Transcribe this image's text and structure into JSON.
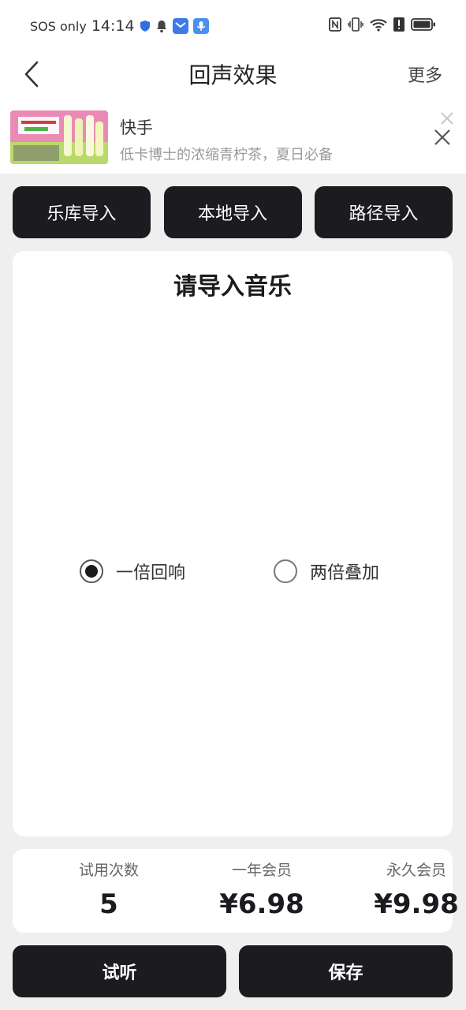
{
  "status_bar": {
    "carrier": "SOS only",
    "time": "14:14"
  },
  "header": {
    "title": "回声效果",
    "more_label": "更多"
  },
  "ad": {
    "title": "快手",
    "description": "低卡博士的浓缩青柠茶，夏日必备"
  },
  "import_buttons": [
    "乐库导入",
    "本地导入",
    "路径导入"
  ],
  "card": {
    "title": "请导入音乐",
    "options": [
      {
        "label": "一倍回响",
        "selected": true
      },
      {
        "label": "两倍叠加",
        "selected": false
      }
    ]
  },
  "pricing": [
    {
      "label": "试用次数",
      "value": "5"
    },
    {
      "label": "一年会员",
      "value": "¥6.98"
    },
    {
      "label": "永久会员",
      "value": "¥9.98"
    }
  ],
  "actions": {
    "preview_label": "试听",
    "save_label": "保存"
  },
  "colors": {
    "button_bg": "#1b1b20",
    "page_bg": "#efefef"
  }
}
